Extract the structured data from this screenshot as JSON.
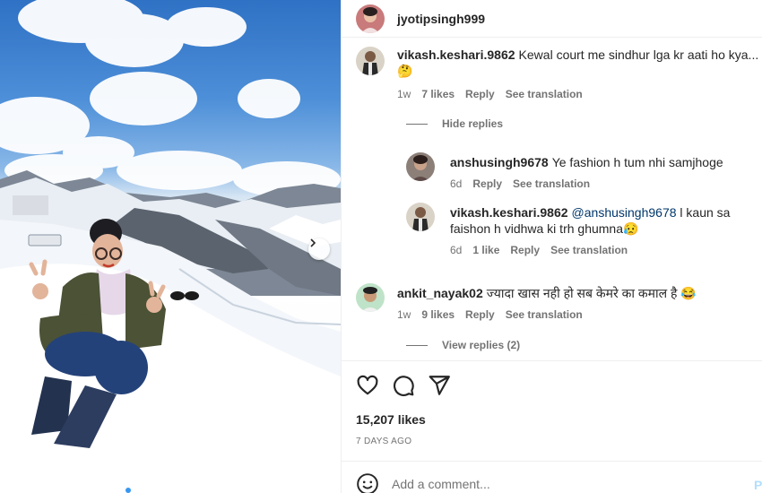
{
  "post": {
    "author": "jyotipsingh999",
    "likes": "15,207 likes",
    "date": "7 DAYS AGO",
    "carousel": {
      "total_dots": 3,
      "active_index": 0
    }
  },
  "comments": [
    {
      "username": "vikash.keshari.9862",
      "text": "Kewal court me sindhur lga kr aati ho kya...",
      "emoji": "🤔",
      "age": "1w",
      "likes": "7 likes",
      "reply": "Reply",
      "translate": "See translation",
      "replies_toggle": "Hide replies",
      "replies": [
        {
          "username": "anshusingh9678",
          "text": "Ye fashion h tum nhi samjhoge",
          "age": "6d",
          "reply": "Reply",
          "translate": "See translation"
        },
        {
          "username": "vikash.keshari.9862",
          "mention": "@anshusingh9678",
          "text": "l kaun sa faishon h vidhwa ki trh ghumna",
          "emoji": "😥",
          "age": "6d",
          "likes": "1 like",
          "reply": "Reply",
          "translate": "See translation"
        }
      ]
    },
    {
      "username": "ankit_nayak02",
      "text": "ज्यादा खास नही हो सब केमरे का कमाल है",
      "emoji": "😂",
      "age": "1w",
      "likes": "9 likes",
      "reply": "Reply",
      "translate": "See translation",
      "replies_toggle": "View replies (2)"
    }
  ],
  "composer": {
    "placeholder": "Add a comment...",
    "post_label": "P"
  },
  "icons": {
    "like": "heart-icon",
    "comment": "comment-bubble-icon",
    "share": "paper-plane-icon",
    "emoji": "smiley-icon",
    "next": "chevron-right-icon"
  },
  "colors": {
    "text": "#262626",
    "secondary": "#737373",
    "link": "#00376b",
    "accent": "#3797f0",
    "post_disabled": "#b2dffc"
  }
}
